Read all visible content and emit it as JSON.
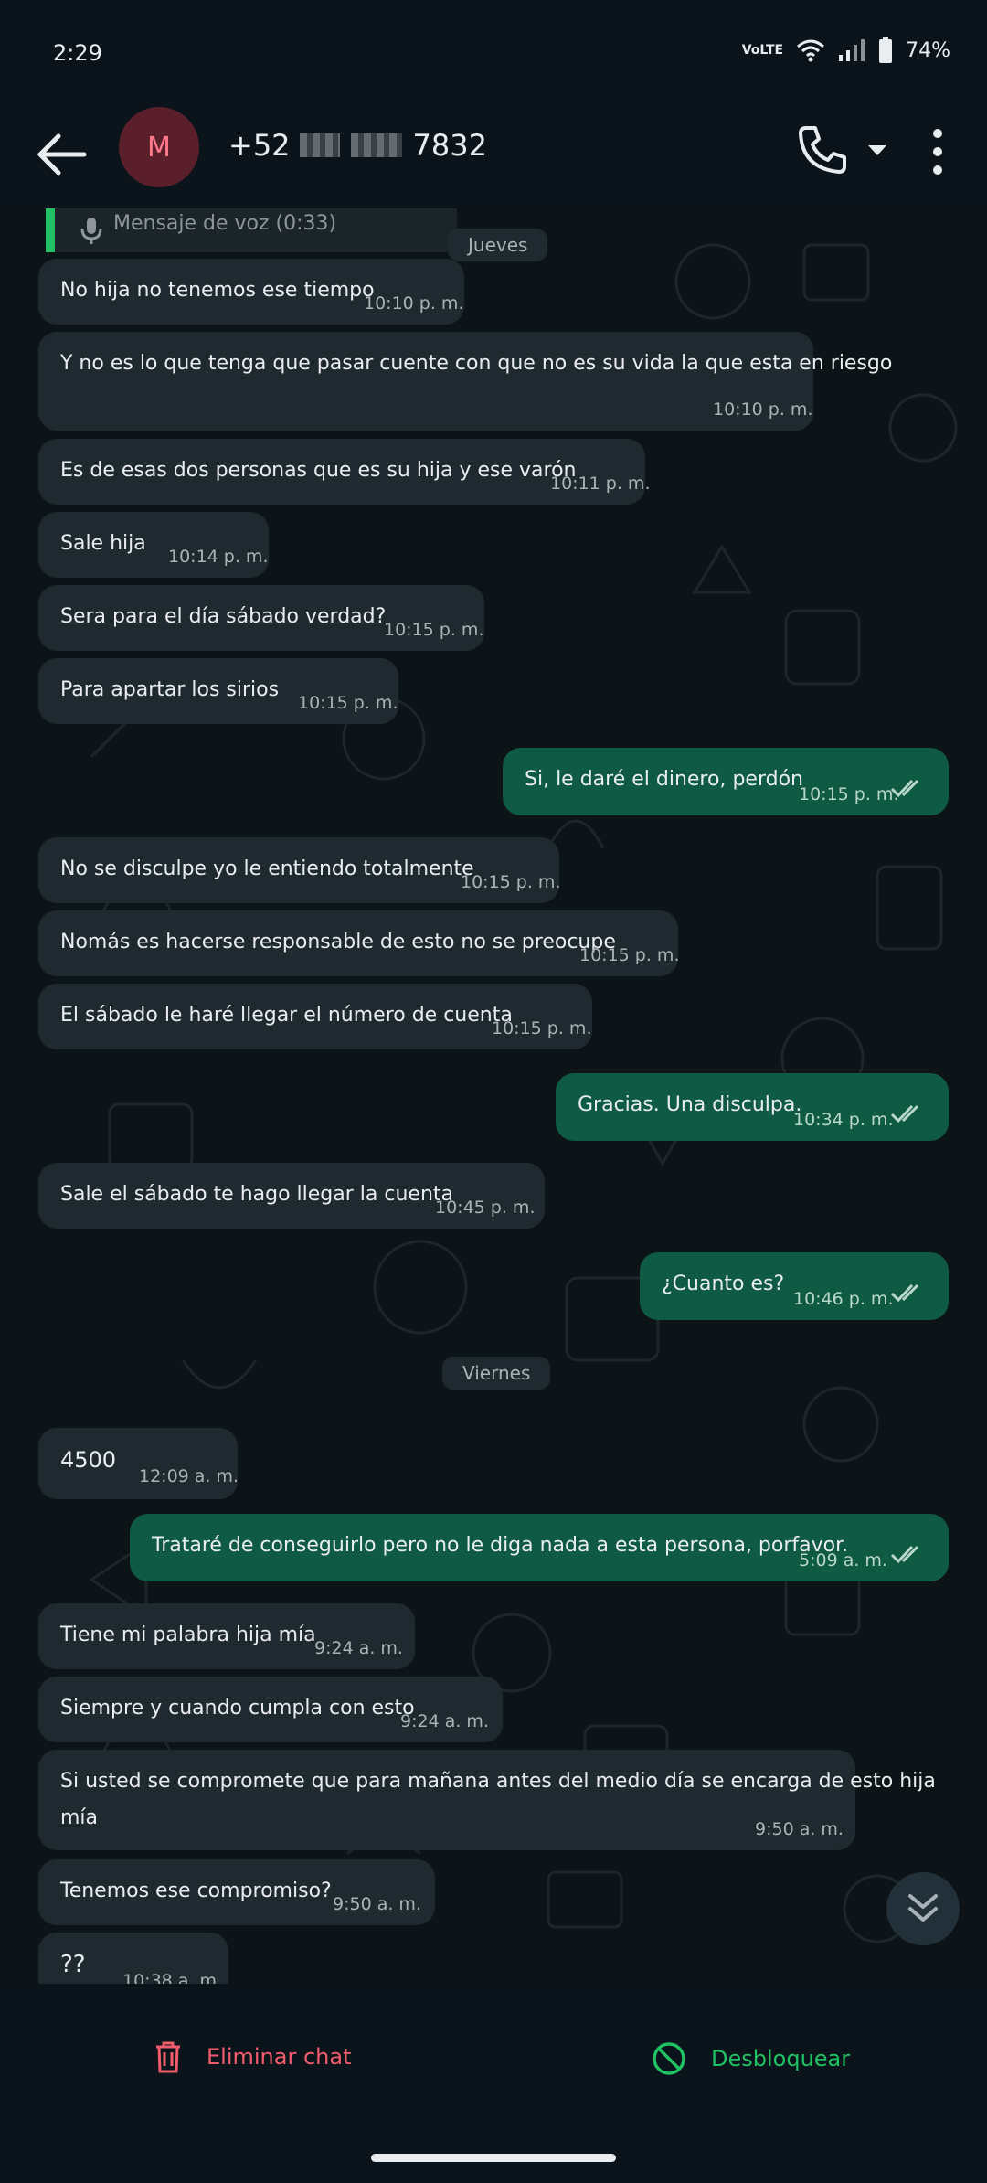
{
  "status_bar": {
    "time": "2:29",
    "network_label": "VoLTE",
    "battery": "74%"
  },
  "header": {
    "avatar_initial": "M",
    "contact_prefix": "+52",
    "contact_suffix": "7832"
  },
  "voice_message": {
    "label": "Mensaje de voz (0:33)"
  },
  "day_labels": {
    "thursday": "Jueves",
    "friday": "Viernes"
  },
  "messages": [
    {
      "dir": "in",
      "text": "No hija no tenemos ese tiempo",
      "time": "10:10 p. m."
    },
    {
      "dir": "in",
      "text": "Y no es lo que tenga que pasar cuente con que no es su vida la que esta en riesgo",
      "time": "10:10 p. m."
    },
    {
      "dir": "in",
      "text": "Es de esas dos personas que es su hija y ese varón",
      "time": "10:11 p. m."
    },
    {
      "dir": "in",
      "text": "Sale hija",
      "time": "10:14 p. m."
    },
    {
      "dir": "in",
      "text": "Sera para el día sábado verdad?",
      "time": "10:15 p. m."
    },
    {
      "dir": "in",
      "text": "Para apartar los sirios",
      "time": "10:15 p. m."
    },
    {
      "dir": "out",
      "text": "Si, le daré el dinero, perdón",
      "time": "10:15 p. m."
    },
    {
      "dir": "in",
      "text": "No se disculpe yo le entiendo totalmente",
      "time": "10:15 p. m."
    },
    {
      "dir": "in",
      "text": "Nomás es hacerse responsable de esto no se preocupe",
      "time": "10:15 p. m."
    },
    {
      "dir": "in",
      "text": "El sábado le haré llegar el número de cuenta",
      "time": "10:15 p. m."
    },
    {
      "dir": "out",
      "text": "Gracias. Una disculpa.",
      "time": "10:34 p. m."
    },
    {
      "dir": "in",
      "text": "Sale el sábado te hago llegar la cuenta",
      "time": "10:45 p. m."
    },
    {
      "dir": "out",
      "text": "¿Cuanto es?",
      "time": "10:46 p. m."
    },
    {
      "dir": "in",
      "text": "4500",
      "time": "12:09 a. m."
    },
    {
      "dir": "out",
      "text": "Trataré de conseguirlo pero no le diga nada a esta persona, porfavor.",
      "time": "5:09 a. m."
    },
    {
      "dir": "in",
      "text": "Tiene mi palabra hija mía",
      "time": "9:24 a. m."
    },
    {
      "dir": "in",
      "text": "Siempre y cuando cumpla con esto",
      "time": "9:24 a. m."
    },
    {
      "dir": "in",
      "text": "Si usted se compromete que para mañana antes del medio día se encarga de esto hija",
      "text2": "mía",
      "time": "9:50 a. m."
    },
    {
      "dir": "in",
      "text": "Tenemos ese compromiso?",
      "time": "9:50 a. m."
    },
    {
      "dir": "in",
      "text": "??",
      "time": "10:38 a. m."
    }
  ],
  "bottom_actions": {
    "delete_label": "Eliminar chat",
    "unblock_label": "Desbloquear"
  },
  "colors": {
    "incoming_bubble": "#1f2a30",
    "outgoing_bubble": "#0f5a43",
    "accent_green": "#21c063",
    "danger_red": "#f15c6d"
  },
  "icons": [
    "back-arrow-icon",
    "phone-icon",
    "chevron-down-icon",
    "more-vert-icon",
    "mic-icon",
    "double-check-icon",
    "scroll-down-icon",
    "trash-icon",
    "unblock-icon"
  ]
}
